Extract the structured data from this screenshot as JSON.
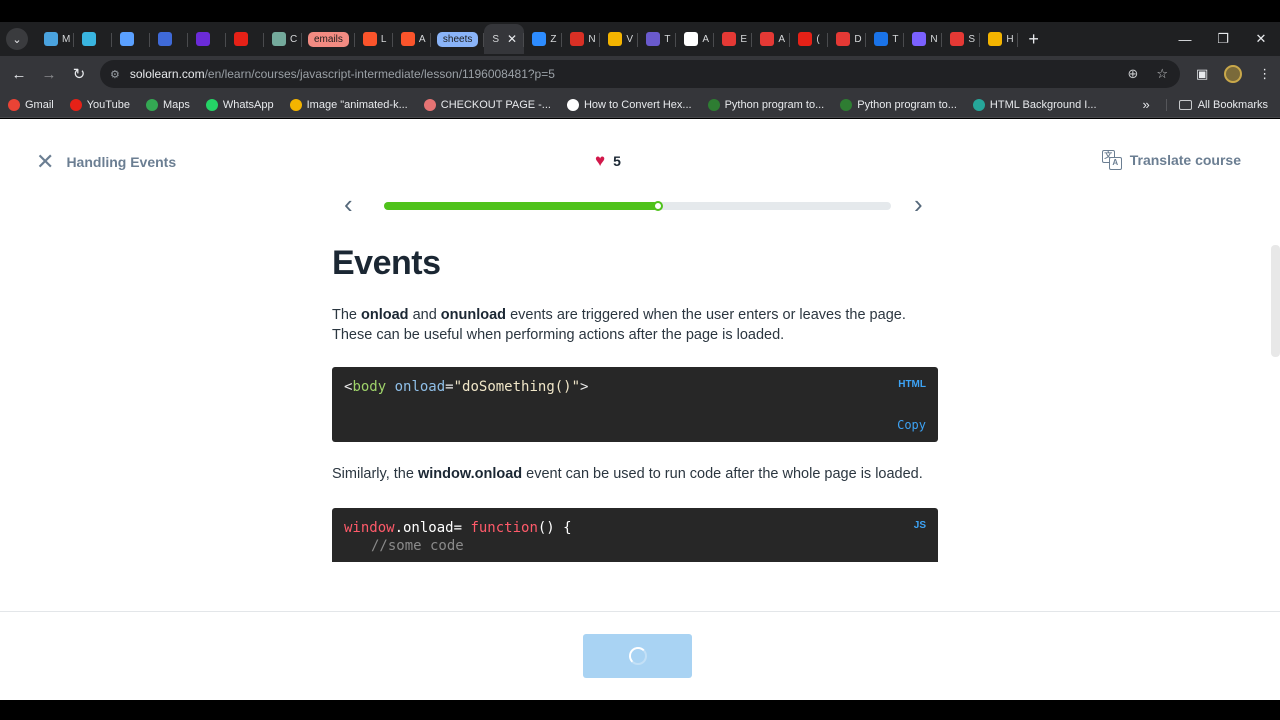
{
  "browser": {
    "tabs": [
      {
        "icon": "gmail-m-icon",
        "color": "#4aa3df",
        "letter": "M"
      },
      {
        "icon": "play-icon",
        "color": "#39b5e0",
        "letter": ""
      },
      {
        "icon": "circle-icon",
        "color": "#5aa0ff",
        "letter": ""
      },
      {
        "icon": "crown-icon",
        "color": "#3f6ad8",
        "letter": ""
      },
      {
        "icon": "upwork-icon",
        "color": "#6b2bd8",
        "letter": ""
      },
      {
        "icon": "youtube-icon",
        "color": "#e62117",
        "letter": ""
      },
      {
        "icon": "chatgpt-icon",
        "color": "#74aa9c",
        "letter": "C"
      },
      {
        "icon": "emails-chip",
        "color": "#f28b82",
        "chip": "emails"
      },
      {
        "icon": "brave-icon",
        "color": "#fb542b",
        "letter": "L"
      },
      {
        "icon": "brave-icon",
        "color": "#fb542b",
        "letter": "A"
      },
      {
        "icon": "sheets-chip",
        "color": "#8ab4f8",
        "chip": "sheets"
      },
      {
        "icon": "active-tab",
        "letter": "S",
        "active": true
      },
      {
        "icon": "zoom-icon",
        "color": "#2d8cff",
        "letter": "Z"
      },
      {
        "icon": "mail-icon",
        "color": "#d93025",
        "letter": "N"
      },
      {
        "icon": "drive-icon",
        "color": "#f4b400",
        "letter": "V"
      },
      {
        "icon": "globe-icon",
        "color": "#6a5acd",
        "letter": "T"
      },
      {
        "icon": "d-icon",
        "color": "#ffffff",
        "letter": "A"
      },
      {
        "icon": "e-icon",
        "color": "#e53935",
        "letter": "E"
      },
      {
        "icon": "co-icon",
        "color": "#e53935",
        "letter": "A"
      },
      {
        "icon": "youtube-icon",
        "color": "#e62117",
        "letter": "("
      },
      {
        "icon": "opera-icon",
        "color": "#e53935",
        "letter": "D"
      },
      {
        "icon": "c-icon",
        "color": "#1a73e8",
        "letter": "T"
      },
      {
        "icon": "video-icon",
        "color": "#7b61ff",
        "letter": "N"
      },
      {
        "icon": "co-icon",
        "color": "#e53935",
        "letter": "S"
      },
      {
        "icon": "chrome-icon",
        "color": "#f4b400",
        "letter": "H"
      }
    ],
    "url_host": "sololearn.com",
    "url_path": "/en/learn/courses/javascript-intermediate/lesson/1196008481?p=5",
    "bookmarks": [
      {
        "label": "Gmail",
        "color": "#ea4335"
      },
      {
        "label": "YouTube",
        "color": "#e62117"
      },
      {
        "label": "Maps",
        "color": "#34a853"
      },
      {
        "label": "WhatsApp",
        "color": "#25d366"
      },
      {
        "label": "Image \"animated-k...",
        "color": "#f4b400"
      },
      {
        "label": "CHECKOUT PAGE -...",
        "color": "#e57373"
      },
      {
        "label": "How to Convert Hex...",
        "color": "#ffffff"
      },
      {
        "label": "Python program to...",
        "color": "#2e7d32"
      },
      {
        "label": "Python program to...",
        "color": "#2e7d32"
      },
      {
        "label": "HTML Background I...",
        "color": "#26a69a"
      }
    ],
    "more_label": "»",
    "all_bookmarks": "All Bookmarks"
  },
  "lesson": {
    "back_label": "Handling Events",
    "hearts": "5",
    "translate_label": "Translate course",
    "progress": 0.54,
    "title": "Events",
    "para1_pre": "The ",
    "para1_b1": "onload",
    "para1_mid": " and ",
    "para1_b2": "onunload",
    "para1_post": " events are triggered when the user enters or leaves the page. These can be useful when performing actions after the page is loaded.",
    "code1_lang": "HTML",
    "code1_copy": "Copy",
    "code1_open": "<",
    "code1_tag": "body",
    "code1_attr": "onload",
    "code1_eq": "=",
    "code1_value": "\"doSomething()\"",
    "code1_close": ">",
    "para2_pre": "Similarly, the ",
    "para2_b": "window.onload",
    "para2_post": " event can be used to run code after the whole page is loaded.",
    "code2_lang": "JS",
    "code2_obj": "window",
    "code2_prop": ".onload= ",
    "code2_kw": "function",
    "code2_rest": "() {",
    "code2_comment": "//some code"
  }
}
